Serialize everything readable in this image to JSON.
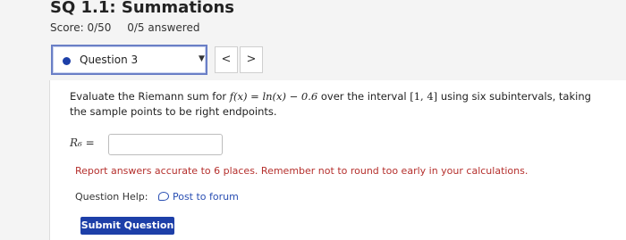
{
  "header": {
    "title": "SQ 1.1: Summations",
    "score": "Score: 0/50",
    "answered": "0/5 answered"
  },
  "question_nav": {
    "selected_question": "Question 3",
    "prev_label": "<",
    "next_label": ">"
  },
  "problem": {
    "text_1": "Evaluate the Riemann sum for",
    "f": "f(x) = ln(x) − 0.6",
    "text_2": "over the interval",
    "interval": "[1, 4]",
    "text_3": "using six subintervals, taking the sample points to be right endpoints.",
    "answer_label": "R₆ =",
    "answer_value": "",
    "notice": "Report answers accurate to 6 places. Remember not to round too early in your calculations.",
    "help_label": "Question Help:",
    "help_link": "Post to forum",
    "submit_label": "Submit Question"
  },
  "colors": {
    "accent": "#1d3fa8",
    "notice": "#b5302d"
  }
}
